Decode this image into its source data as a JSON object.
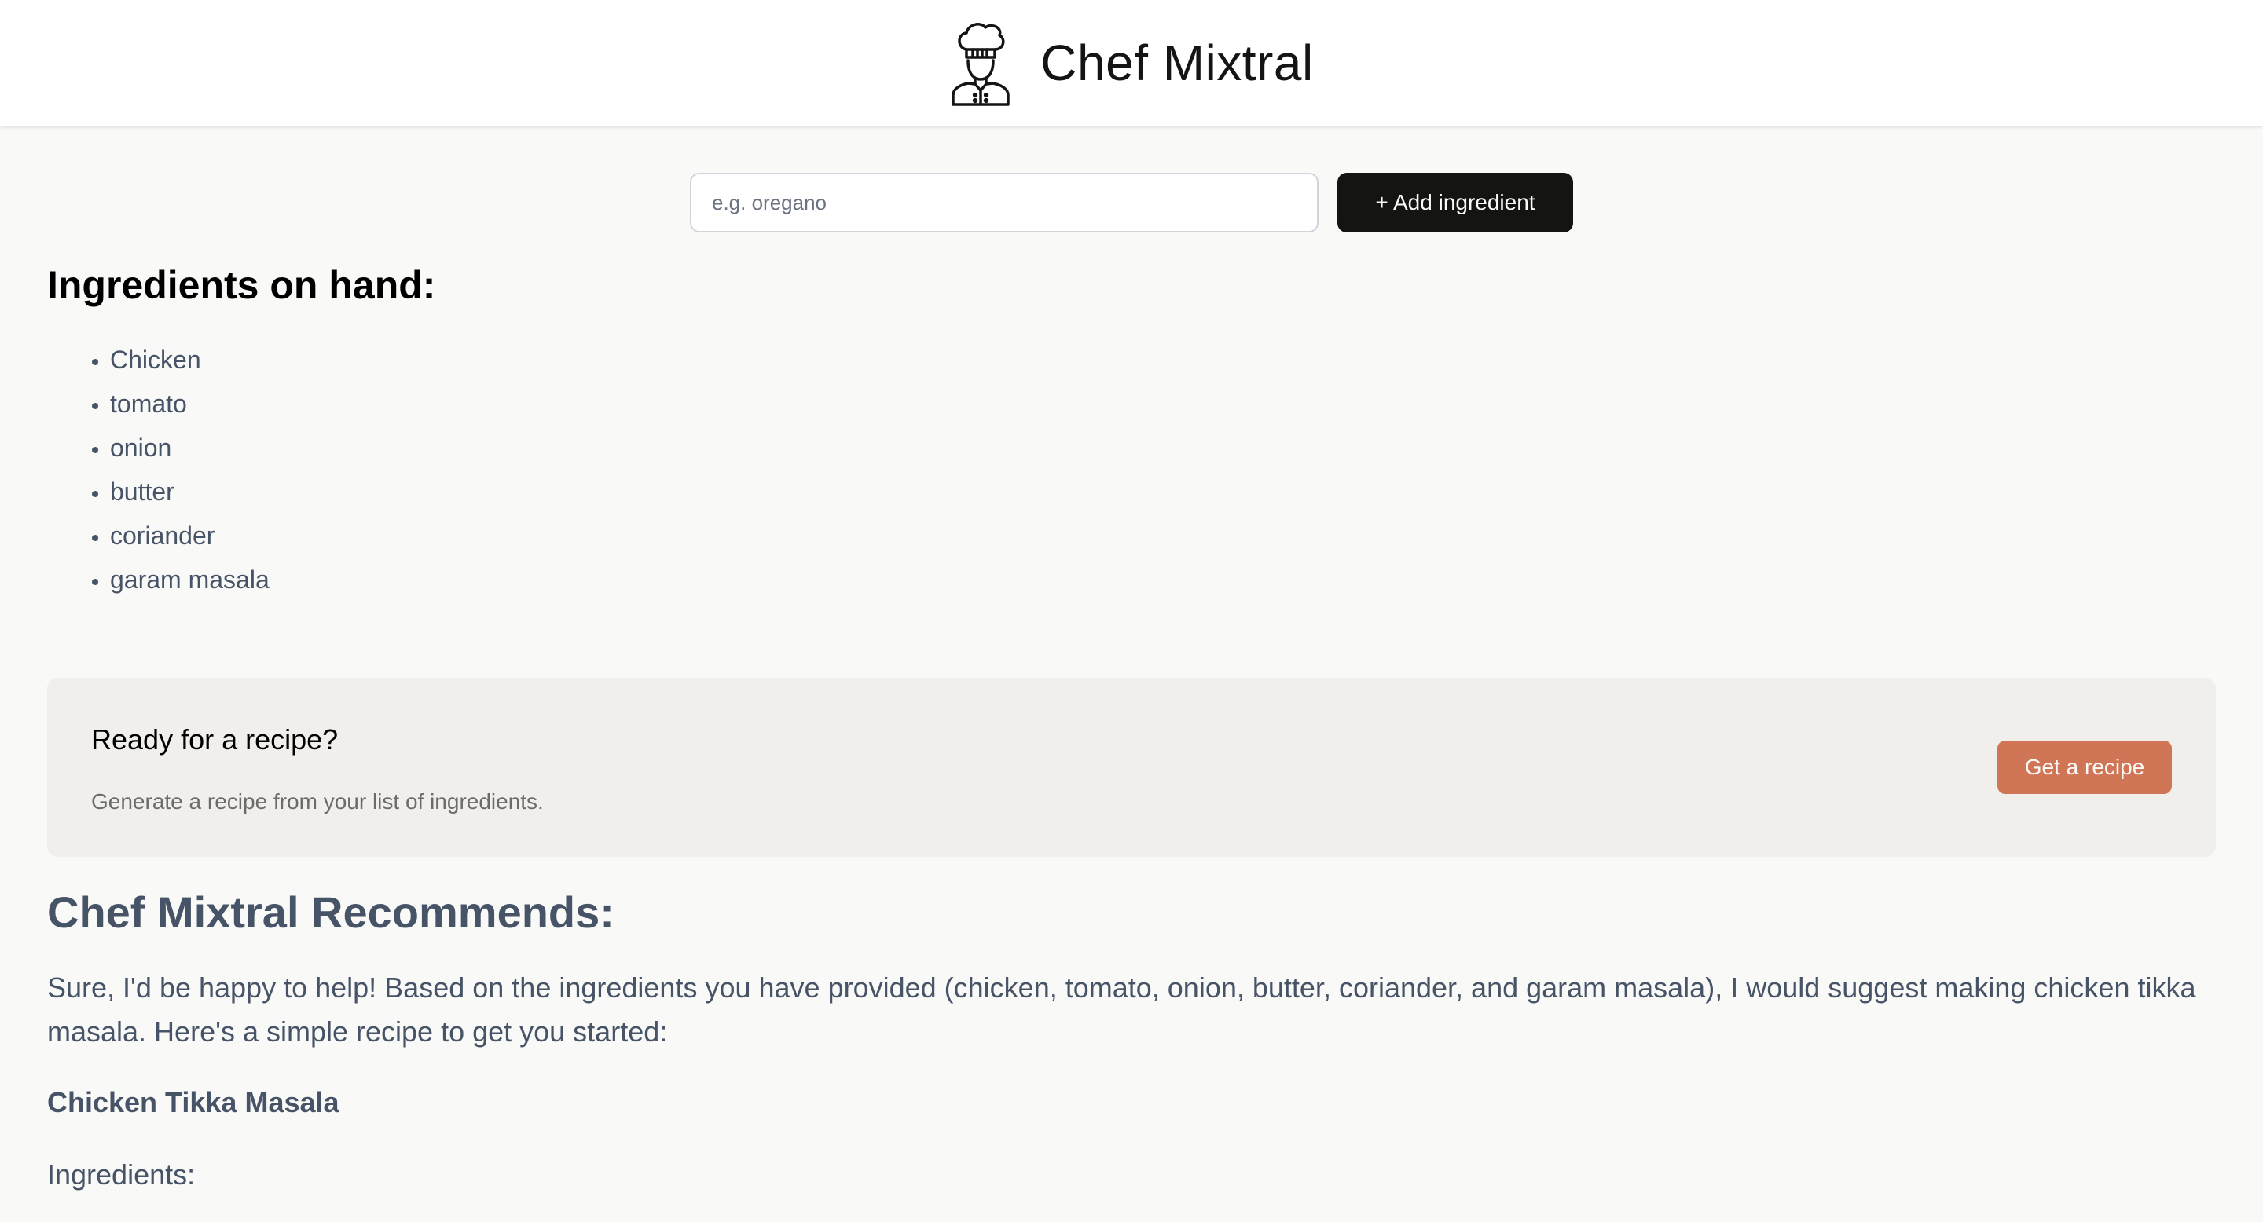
{
  "header": {
    "logo_icon": "chef-icon",
    "title": "Chef Mixtral"
  },
  "add_form": {
    "input_placeholder": "e.g. oregano",
    "input_value": "",
    "add_button_label": "+ Add ingredient"
  },
  "ingredients": {
    "heading": "Ingredients on hand:",
    "items": [
      "Chicken",
      "tomato",
      "onion",
      "butter",
      "coriander",
      "garam masala"
    ]
  },
  "cta": {
    "title": "Ready for a recipe?",
    "subtitle": "Generate a recipe from your list of ingredients.",
    "button_label": "Get a recipe"
  },
  "recipe": {
    "heading": "Chef Mixtral Recommends:",
    "intro": "Sure, I'd be happy to help! Based on the ingredients you have provided (chicken, tomato, onion, butter, coriander, and garam masala), I would suggest making chicken tikka masala. Here's a simple recipe to get you started:",
    "name": "Chicken Tikka Masala",
    "ingredients_heading": "Ingredients:"
  },
  "colors": {
    "page_background": "#f9f9f7",
    "header_background": "#ffffff",
    "primary_button": "#141413",
    "accent_button": "#d17557",
    "cta_background": "#f0efec",
    "recipe_text": "#475467"
  }
}
